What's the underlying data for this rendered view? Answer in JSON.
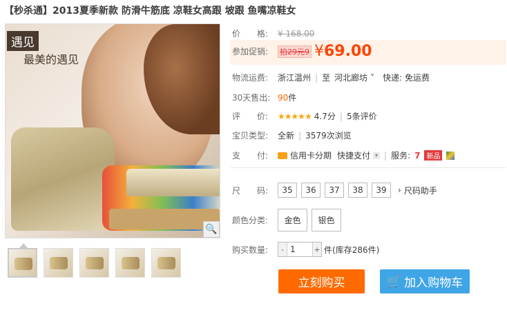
{
  "title": "【秒杀通】2013夏季新款 防滑牛筋底 凉鞋女高跟 坡跟 鱼嘴凉鞋女",
  "image": {
    "badge": "遇见",
    "slogan": "最美的遇见"
  },
  "price": {
    "label": "价　　格:",
    "original": "¥ 168.00"
  },
  "promo": {
    "label": "参加促销:",
    "tag": "拍29元9",
    "currency": "¥",
    "value": "69.00"
  },
  "shipping": {
    "label": "物流运费:",
    "from": "浙江温州",
    "to_sep": "至",
    "to": "河北廊坊",
    "express": "快递: 免运费"
  },
  "sales": {
    "label": "30天售出:",
    "count": "90",
    "unit": "件"
  },
  "rating": {
    "label": "评　　价:",
    "stars": "★★★★★",
    "score": "4.7分",
    "reviews": "5条评价"
  },
  "type": {
    "label": "宝贝类型:",
    "condition": "全新",
    "views": "3579次浏览"
  },
  "payment": {
    "label": "支　　付:",
    "installment": "信用卡分期",
    "quick": "快捷支付",
    "service_label": "服务:",
    "new_tag": "新品",
    "seven_tag": "7"
  },
  "sizes": {
    "label": "尺　　码:",
    "options": [
      "35",
      "36",
      "37",
      "38",
      "39"
    ],
    "helper": "尺码助手"
  },
  "colors": {
    "label": "颜色分类:",
    "options": [
      "金色",
      "银色"
    ]
  },
  "quantity": {
    "label": "购买数量:",
    "value": "1",
    "minus": "-",
    "plus": "+",
    "unit": "件",
    "stock": "(库存286件)"
  },
  "actions": {
    "buy": "立刻购买",
    "cart": "加入购物车"
  },
  "colors_theme": {
    "accent": "#ff6a00",
    "cart": "#3fa5e6",
    "price": "#ff4400"
  }
}
